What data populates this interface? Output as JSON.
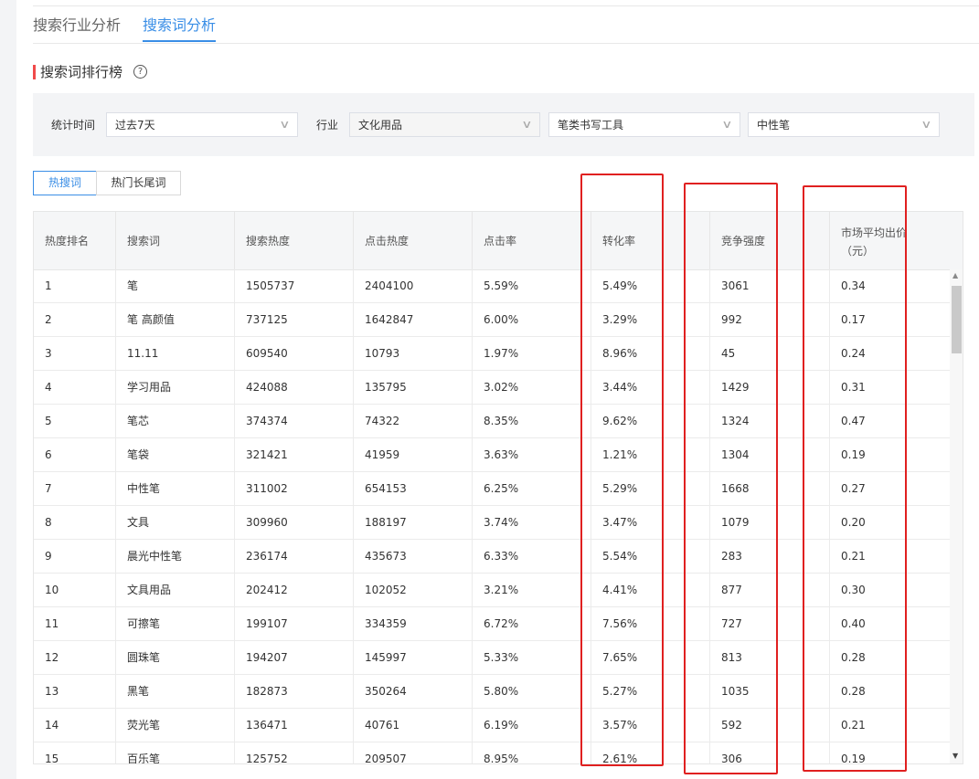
{
  "tabs": [
    {
      "label": "搜索行业分析",
      "active": false
    },
    {
      "label": "搜索词分析",
      "active": true
    }
  ],
  "section": {
    "title": "搜索词排行榜",
    "help_icon": "question-circle-icon"
  },
  "filters": {
    "time_label": "统计时间",
    "time_value": "过去7天",
    "industry_label": "行业",
    "industry_value": "文化用品",
    "category_value": "笔类书写工具",
    "subcategory_value": "中性笔"
  },
  "subtabs": [
    {
      "label": "热搜词",
      "active": true
    },
    {
      "label": "热门长尾词",
      "active": false
    }
  ],
  "table": {
    "headers": [
      "热度排名",
      "搜索词",
      "搜索热度",
      "点击热度",
      "点击率",
      "转化率",
      "竞争强度",
      "市场平均出价（元）"
    ],
    "rows": [
      [
        "1",
        "笔",
        "1505737",
        "2404100",
        "5.59%",
        "5.49%",
        "3061",
        "0.34"
      ],
      [
        "2",
        "笔 高颜值",
        "737125",
        "1642847",
        "6.00%",
        "3.29%",
        "992",
        "0.17"
      ],
      [
        "3",
        "11.11",
        "609540",
        "10793",
        "1.97%",
        "8.96%",
        "45",
        "0.24"
      ],
      [
        "4",
        "学习用品",
        "424088",
        "135795",
        "3.02%",
        "3.44%",
        "1429",
        "0.31"
      ],
      [
        "5",
        "笔芯",
        "374374",
        "74322",
        "8.35%",
        "9.62%",
        "1324",
        "0.47"
      ],
      [
        "6",
        "笔袋",
        "321421",
        "41959",
        "3.63%",
        "1.21%",
        "1304",
        "0.19"
      ],
      [
        "7",
        "中性笔",
        "311002",
        "654153",
        "6.25%",
        "5.29%",
        "1668",
        "0.27"
      ],
      [
        "8",
        "文具",
        "309960",
        "188197",
        "3.74%",
        "3.47%",
        "1079",
        "0.20"
      ],
      [
        "9",
        "晨光中性笔",
        "236174",
        "435673",
        "6.33%",
        "5.54%",
        "283",
        "0.21"
      ],
      [
        "10",
        "文具用品",
        "202412",
        "102052",
        "3.21%",
        "4.41%",
        "877",
        "0.30"
      ],
      [
        "11",
        "可擦笔",
        "199107",
        "334359",
        "6.72%",
        "7.56%",
        "727",
        "0.40"
      ],
      [
        "12",
        "圆珠笔",
        "194207",
        "145997",
        "5.33%",
        "7.65%",
        "813",
        "0.28"
      ],
      [
        "13",
        "黑笔",
        "182873",
        "350264",
        "5.80%",
        "5.27%",
        "1035",
        "0.28"
      ],
      [
        "14",
        "荧光笔",
        "136471",
        "40761",
        "6.19%",
        "3.57%",
        "592",
        "0.21"
      ],
      [
        "15",
        "百乐笔",
        "125752",
        "209507",
        "8.95%",
        "2.61%",
        "306",
        "0.19"
      ]
    ]
  },
  "scrollbar": {
    "up_icon": "triangle-up-icon",
    "down_icon": "triangle-down-icon"
  },
  "highlight_color": "#e02020",
  "accent_color": "#3a8ee6"
}
